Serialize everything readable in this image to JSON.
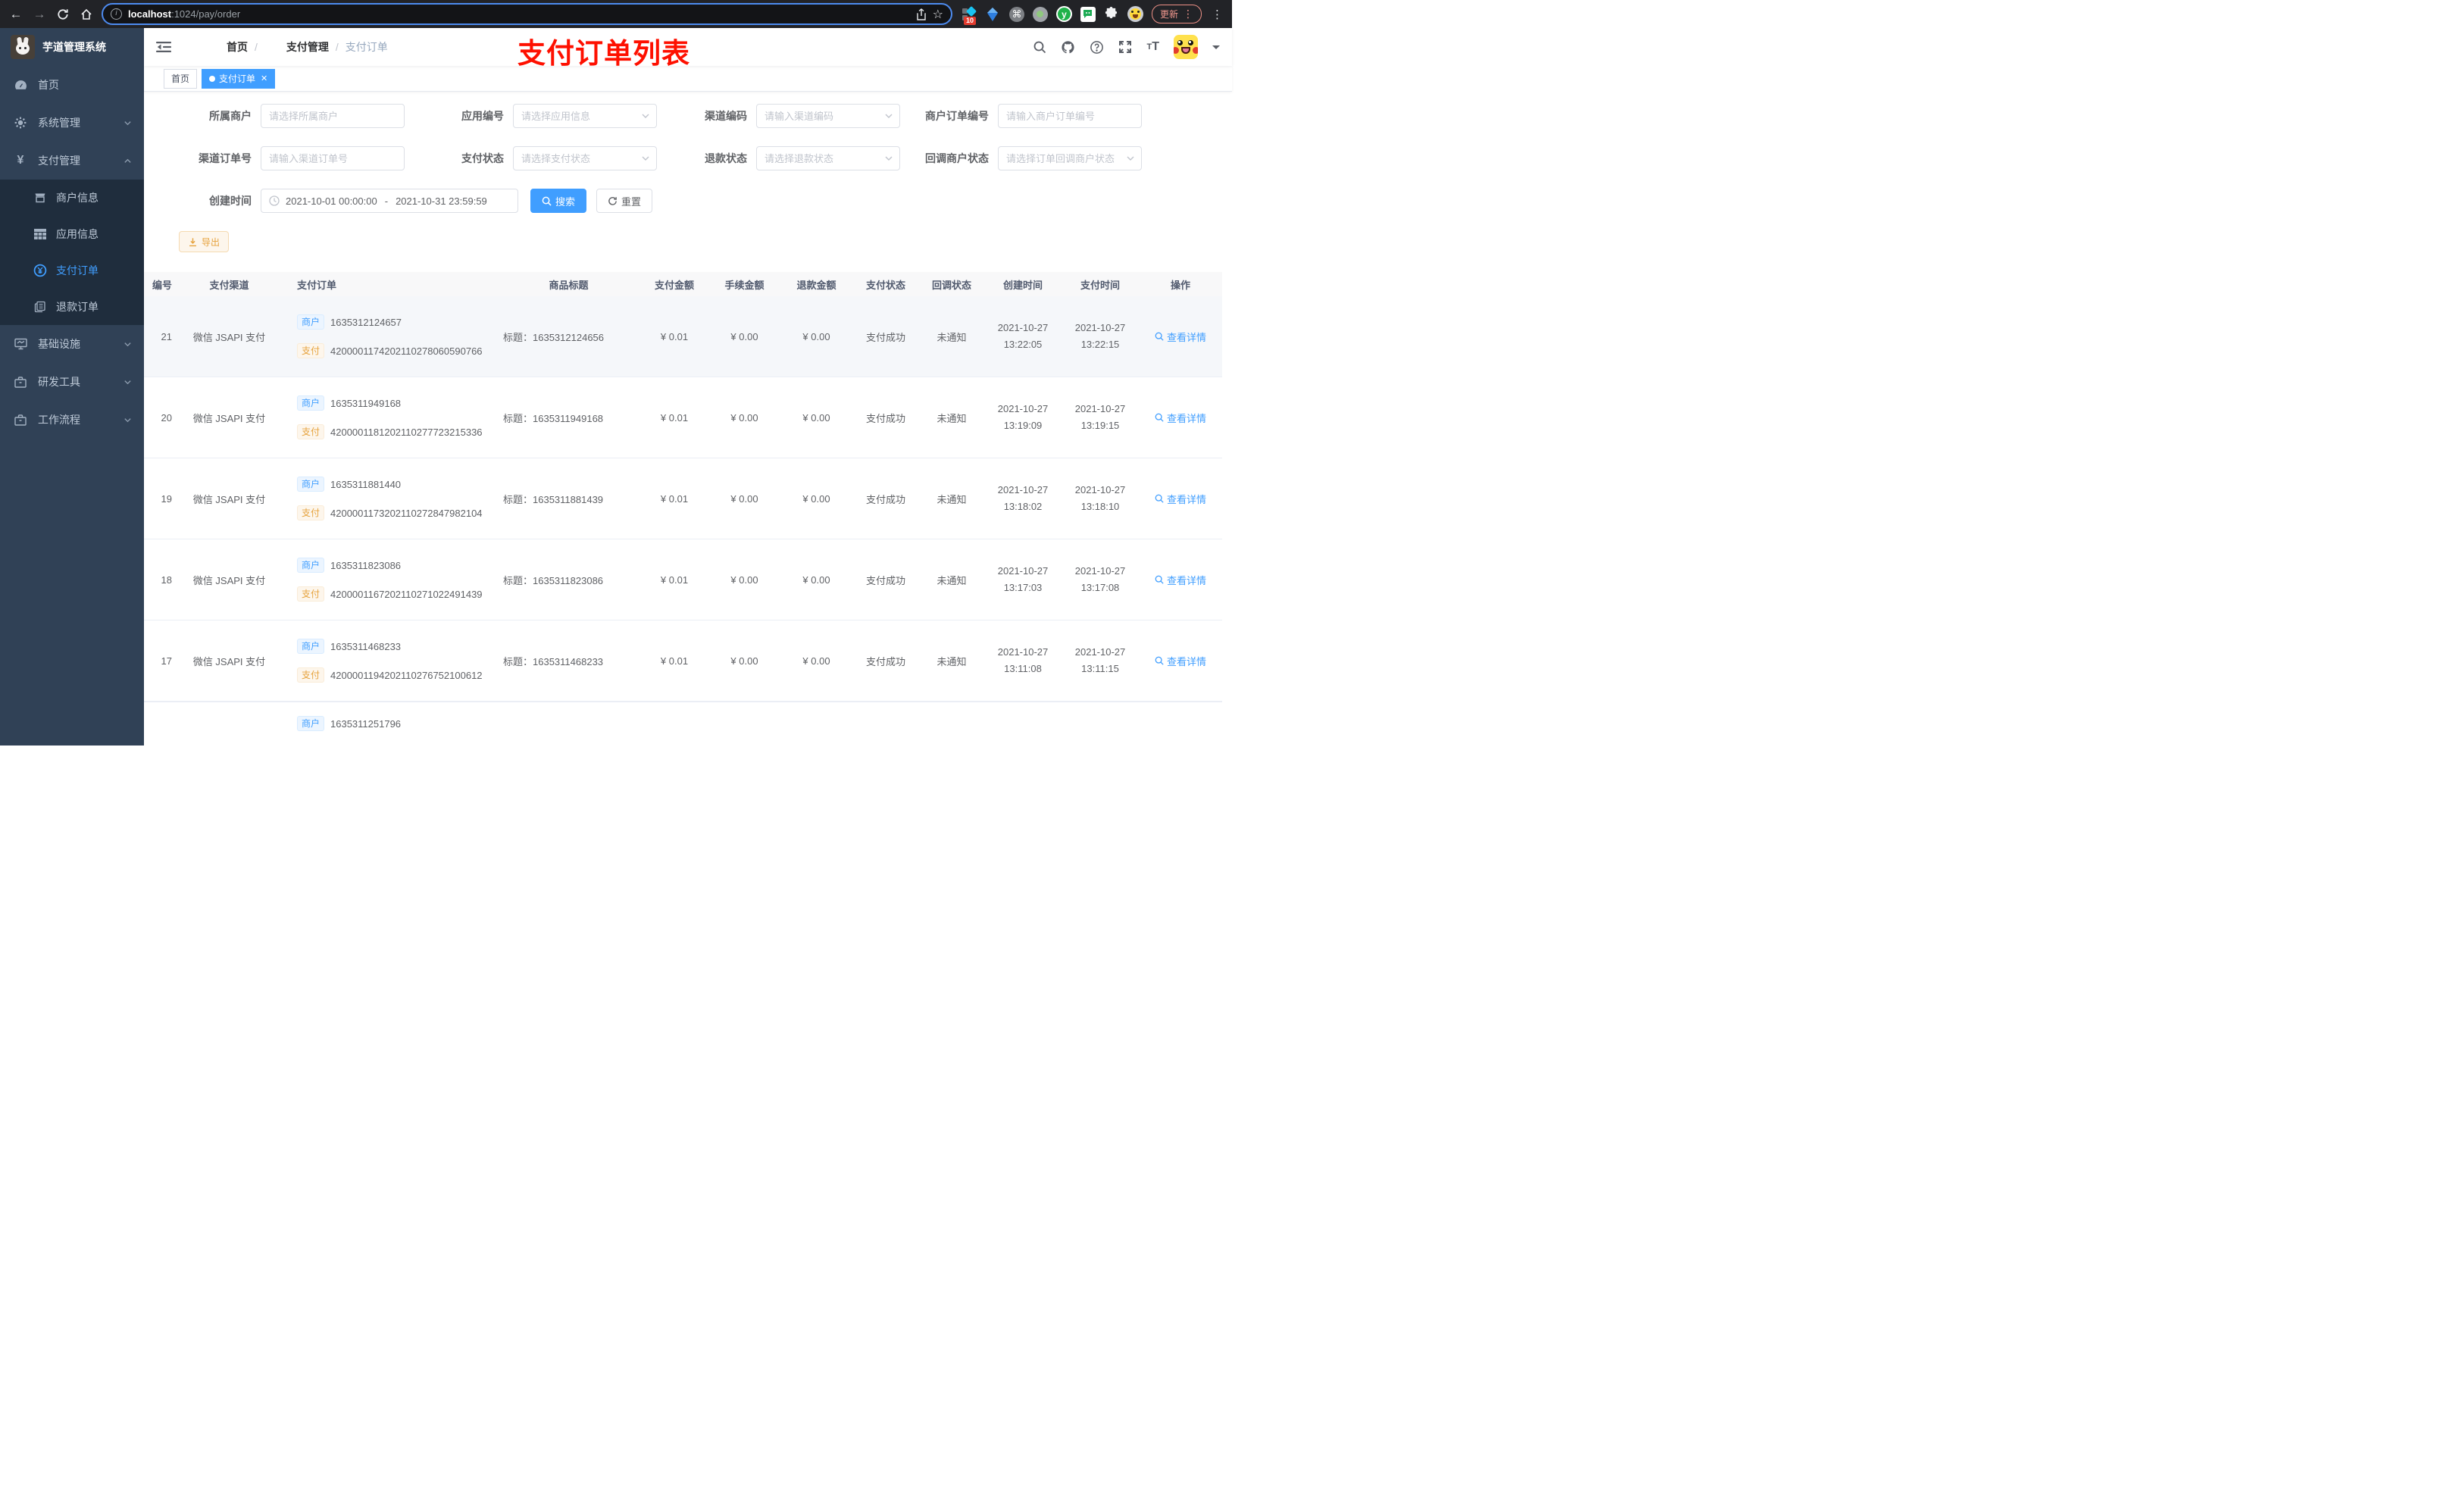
{
  "browser": {
    "url": {
      "host": "localhost",
      "path": ":1024/pay/order"
    },
    "extension_badge": "10",
    "update_label": "更新"
  },
  "sidebar": {
    "title": "芋道管理系统",
    "menu": [
      {
        "label": "首页"
      },
      {
        "label": "系统管理"
      },
      {
        "label": "支付管理"
      },
      {
        "label": "基础设施"
      },
      {
        "label": "研发工具"
      },
      {
        "label": "工作流程"
      }
    ],
    "submenu": [
      {
        "label": "商户信息"
      },
      {
        "label": "应用信息"
      },
      {
        "label": "支付订单"
      },
      {
        "label": "退款订单"
      }
    ]
  },
  "header": {
    "breadcrumb": [
      "首页",
      "支付管理",
      "支付订单"
    ],
    "annotation": "支付订单列表"
  },
  "tags": {
    "home": "首页",
    "active": "支付订单"
  },
  "filters": {
    "row1": [
      {
        "label": "所属商户",
        "placeholder": "请选择所属商户"
      },
      {
        "label": "应用编号",
        "placeholder": "请选择应用信息"
      },
      {
        "label": "渠道编码",
        "placeholder": "请输入渠道编码"
      },
      {
        "label": "商户订单编号",
        "placeholder": "请输入商户订单编号"
      }
    ],
    "row2": [
      {
        "label": "渠道订单号",
        "placeholder": "请输入渠道订单号"
      },
      {
        "label": "支付状态",
        "placeholder": "请选择支付状态"
      },
      {
        "label": "退款状态",
        "placeholder": "请选择退款状态"
      },
      {
        "label": "回调商户状态",
        "placeholder": "请选择订单回调商户状态"
      }
    ],
    "date": {
      "label": "创建时间",
      "start": "2021-10-01 00:00:00",
      "separator": "-",
      "end": "2021-10-31 23:59:59"
    },
    "search_label": "搜索",
    "reset_label": "重置"
  },
  "toolbar": {
    "export_label": "导出"
  },
  "table": {
    "columns": [
      "编号",
      "支付渠道",
      "支付订单",
      "商品标题",
      "支付金额",
      "手续金额",
      "退款金额",
      "支付状态",
      "回调状态",
      "创建时间",
      "支付时间",
      "操作"
    ],
    "tag_merchant": "商户",
    "tag_pay": "支付",
    "title_prefix": "标题：",
    "action_label": "查看详情",
    "rows": [
      {
        "id": "21",
        "channel": "微信 JSAPI 支付",
        "merchant_no": "1635312124657",
        "pay_no": "4200001174202110278060590766",
        "title": "1635312124656",
        "amount": "¥ 0.01",
        "fee": "¥ 0.00",
        "refund": "¥ 0.00",
        "pay_status": "支付成功",
        "notify_status": "未通知",
        "create_date": "2021-10-27",
        "create_time": "13:22:05",
        "pay_date": "2021-10-27",
        "pay_time": "13:22:15"
      },
      {
        "id": "20",
        "channel": "微信 JSAPI 支付",
        "merchant_no": "1635311949168",
        "pay_no": "4200001181202110277723215336",
        "title": "1635311949168",
        "amount": "¥ 0.01",
        "fee": "¥ 0.00",
        "refund": "¥ 0.00",
        "pay_status": "支付成功",
        "notify_status": "未通知",
        "create_date": "2021-10-27",
        "create_time": "13:19:09",
        "pay_date": "2021-10-27",
        "pay_time": "13:19:15"
      },
      {
        "id": "19",
        "channel": "微信 JSAPI 支付",
        "merchant_no": "1635311881440",
        "pay_no": "4200001173202110272847982104",
        "title": "1635311881439",
        "amount": "¥ 0.01",
        "fee": "¥ 0.00",
        "refund": "¥ 0.00",
        "pay_status": "支付成功",
        "notify_status": "未通知",
        "create_date": "2021-10-27",
        "create_time": "13:18:02",
        "pay_date": "2021-10-27",
        "pay_time": "13:18:10"
      },
      {
        "id": "18",
        "channel": "微信 JSAPI 支付",
        "merchant_no": "1635311823086",
        "pay_no": "4200001167202110271022491439",
        "title": "1635311823086",
        "amount": "¥ 0.01",
        "fee": "¥ 0.00",
        "refund": "¥ 0.00",
        "pay_status": "支付成功",
        "notify_status": "未通知",
        "create_date": "2021-10-27",
        "create_time": "13:17:03",
        "pay_date": "2021-10-27",
        "pay_time": "13:17:08"
      },
      {
        "id": "17",
        "channel": "微信 JSAPI 支付",
        "merchant_no": "1635311468233",
        "pay_no": "4200001194202110276752100612",
        "title": "1635311468233",
        "amount": "¥ 0.01",
        "fee": "¥ 0.00",
        "refund": "¥ 0.00",
        "pay_status": "支付成功",
        "notify_status": "未通知",
        "create_date": "2021-10-27",
        "create_time": "13:11:08",
        "pay_date": "2021-10-27",
        "pay_time": "13:11:15"
      }
    ],
    "partial_row": {
      "merchant_no": "1635311251796"
    }
  },
  "colors": {
    "accent": "#409eff",
    "warning": "#e6a23c",
    "annotation": "#fe1000"
  }
}
